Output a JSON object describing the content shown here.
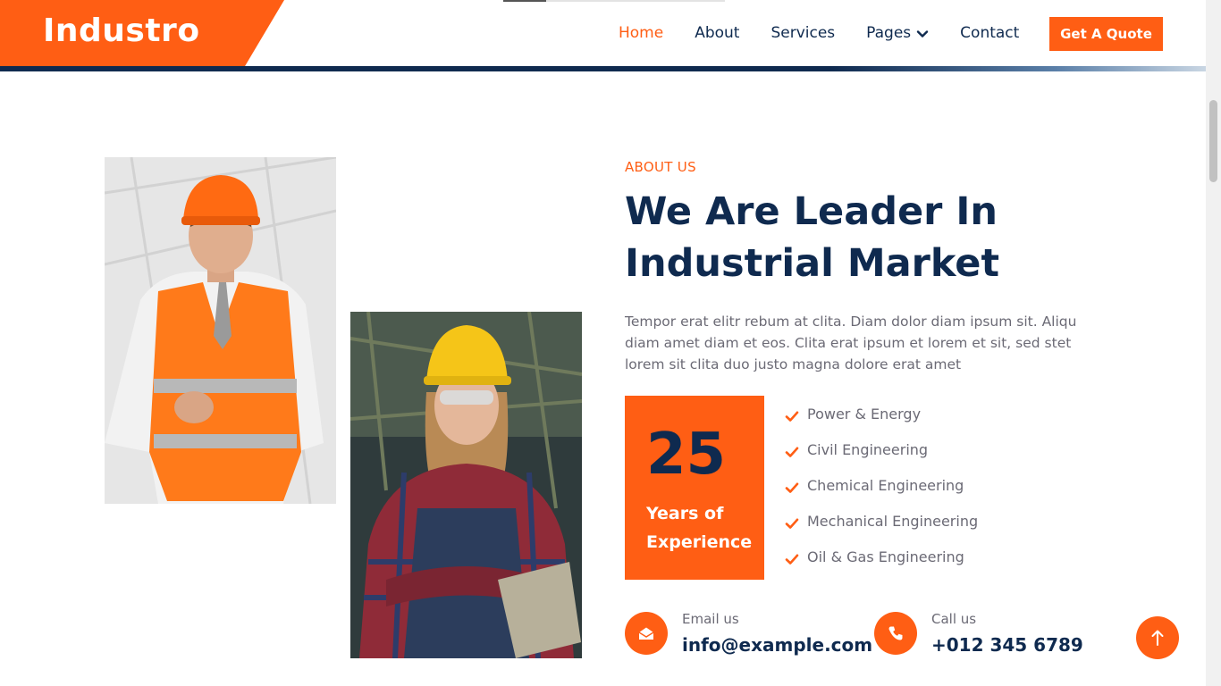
{
  "brand": {
    "name": "Industro"
  },
  "nav": {
    "items": [
      {
        "label": "Home",
        "active": true
      },
      {
        "label": "About",
        "active": false
      },
      {
        "label": "Services",
        "active": false
      },
      {
        "label": "Pages",
        "active": false,
        "dropdown": true
      },
      {
        "label": "Contact",
        "active": false
      }
    ],
    "cta_label": "Get A Quote"
  },
  "about": {
    "eyebrow": "ABOUT US",
    "title_line1": "We Are Leader In",
    "title_line2": "Industrial Market",
    "description": "Tempor erat elitr rebum at clita. Diam dolor diam ipsum sit. Aliqu diam amet diam et eos. Clita erat ipsum et lorem et sit, sed stet lorem sit clita duo justo magna dolore erat amet",
    "experience": {
      "number": "25",
      "label": "Years of Experience"
    },
    "features": [
      "Power & Energy",
      "Civil Engineering",
      "Chemical Engineering",
      "Mechanical Engineering",
      "Oil & Gas Engineering"
    ],
    "contacts": {
      "email": {
        "label": "Email us",
        "value": "info@example.com",
        "icon": "envelope-open-icon"
      },
      "call": {
        "label": "Call us",
        "value": "+012 345 6789",
        "icon": "phone-icon"
      }
    }
  },
  "icons": {
    "feature": "check-icon",
    "dropdown": "chevron-down-icon",
    "back_to_top": "arrow-up-icon"
  },
  "colors": {
    "accent": "#ff5e14",
    "navy": "#0f2a4f",
    "text": "#6b6a75",
    "background": "#ffffff"
  }
}
